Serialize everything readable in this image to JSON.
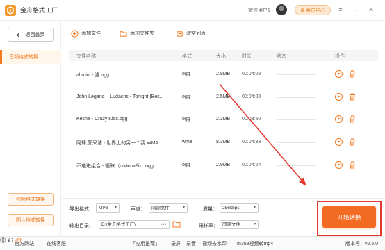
{
  "app": {
    "title": "金舟格式工厂",
    "user_name": "微信用户1",
    "vip_label": "会员中心",
    "window_controls": [
      "menu-icon",
      "minimize-icon",
      "close-icon"
    ]
  },
  "sidebar": {
    "back_label": "返回首页",
    "active_item": "音频格式转换",
    "bottom_buttons": [
      "视频格式转换",
      "图片格式转换"
    ]
  },
  "toolbar": {
    "add_file": "添加文件",
    "add_folder": "添加文件夹",
    "clear_list": "清空列表"
  },
  "table": {
    "headers": {
      "name": "文件名称",
      "format": "格式",
      "size": "大小",
      "duration": "时长",
      "status": "状态",
      "action": "操作"
    },
    "rows": [
      {
        "name": "al mini - 遇.ogg",
        "format": "ogg",
        "size": "2.8MB",
        "duration": "00:04:08",
        "progress": 0
      },
      {
        "name": "John Legend _ Ludacris - Tonight (Bes...",
        "format": "ogg",
        "size": "2.5MB",
        "duration": "00:04:00",
        "progress": 0
      },
      {
        "name": "Kesha - Crazy Kids.ogg",
        "format": "ogg",
        "size": "2.3MB",
        "duration": "00:03:50",
        "progress": 0
      },
      {
        "name": "阿肆,郭采洁 - 世界上的另一个我.WMA",
        "format": "wma",
        "size": "8.3MB",
        "duration": "00:04:33",
        "progress": 0
      },
      {
        "name": "不难进组合 - 暧昧（nuān wěi）.ogg",
        "format": "ogg",
        "size": "2.9MB",
        "duration": "00:04:24",
        "progress": 0
      }
    ]
  },
  "settings": {
    "output_format_label": "导出格式：",
    "output_format_value": "MP3",
    "channel_label": "声道：",
    "channel_value": "同源文件",
    "quality_label": "质量：",
    "quality_value": "256kbps",
    "output_dir_label": "输出目录：",
    "output_dir_value": "D:\\金舟格式工厂\\",
    "output_dir_more": "•••",
    "sample_rate_label": "采样率：",
    "sample_rate_value": "同源文件"
  },
  "start_button": "开始转换",
  "footer": {
    "website": "官方网站",
    "support": "在线客服",
    "recommend": "「应用推荐」",
    "links": [
      "录屏",
      "录音",
      "视频去水印",
      "m3u8视频转mp4"
    ],
    "version": "版本号：v2.5.0"
  },
  "colors": {
    "accent": "#f47a20",
    "start_button": "#f36b22",
    "annotation_red": "#e23b2e"
  }
}
